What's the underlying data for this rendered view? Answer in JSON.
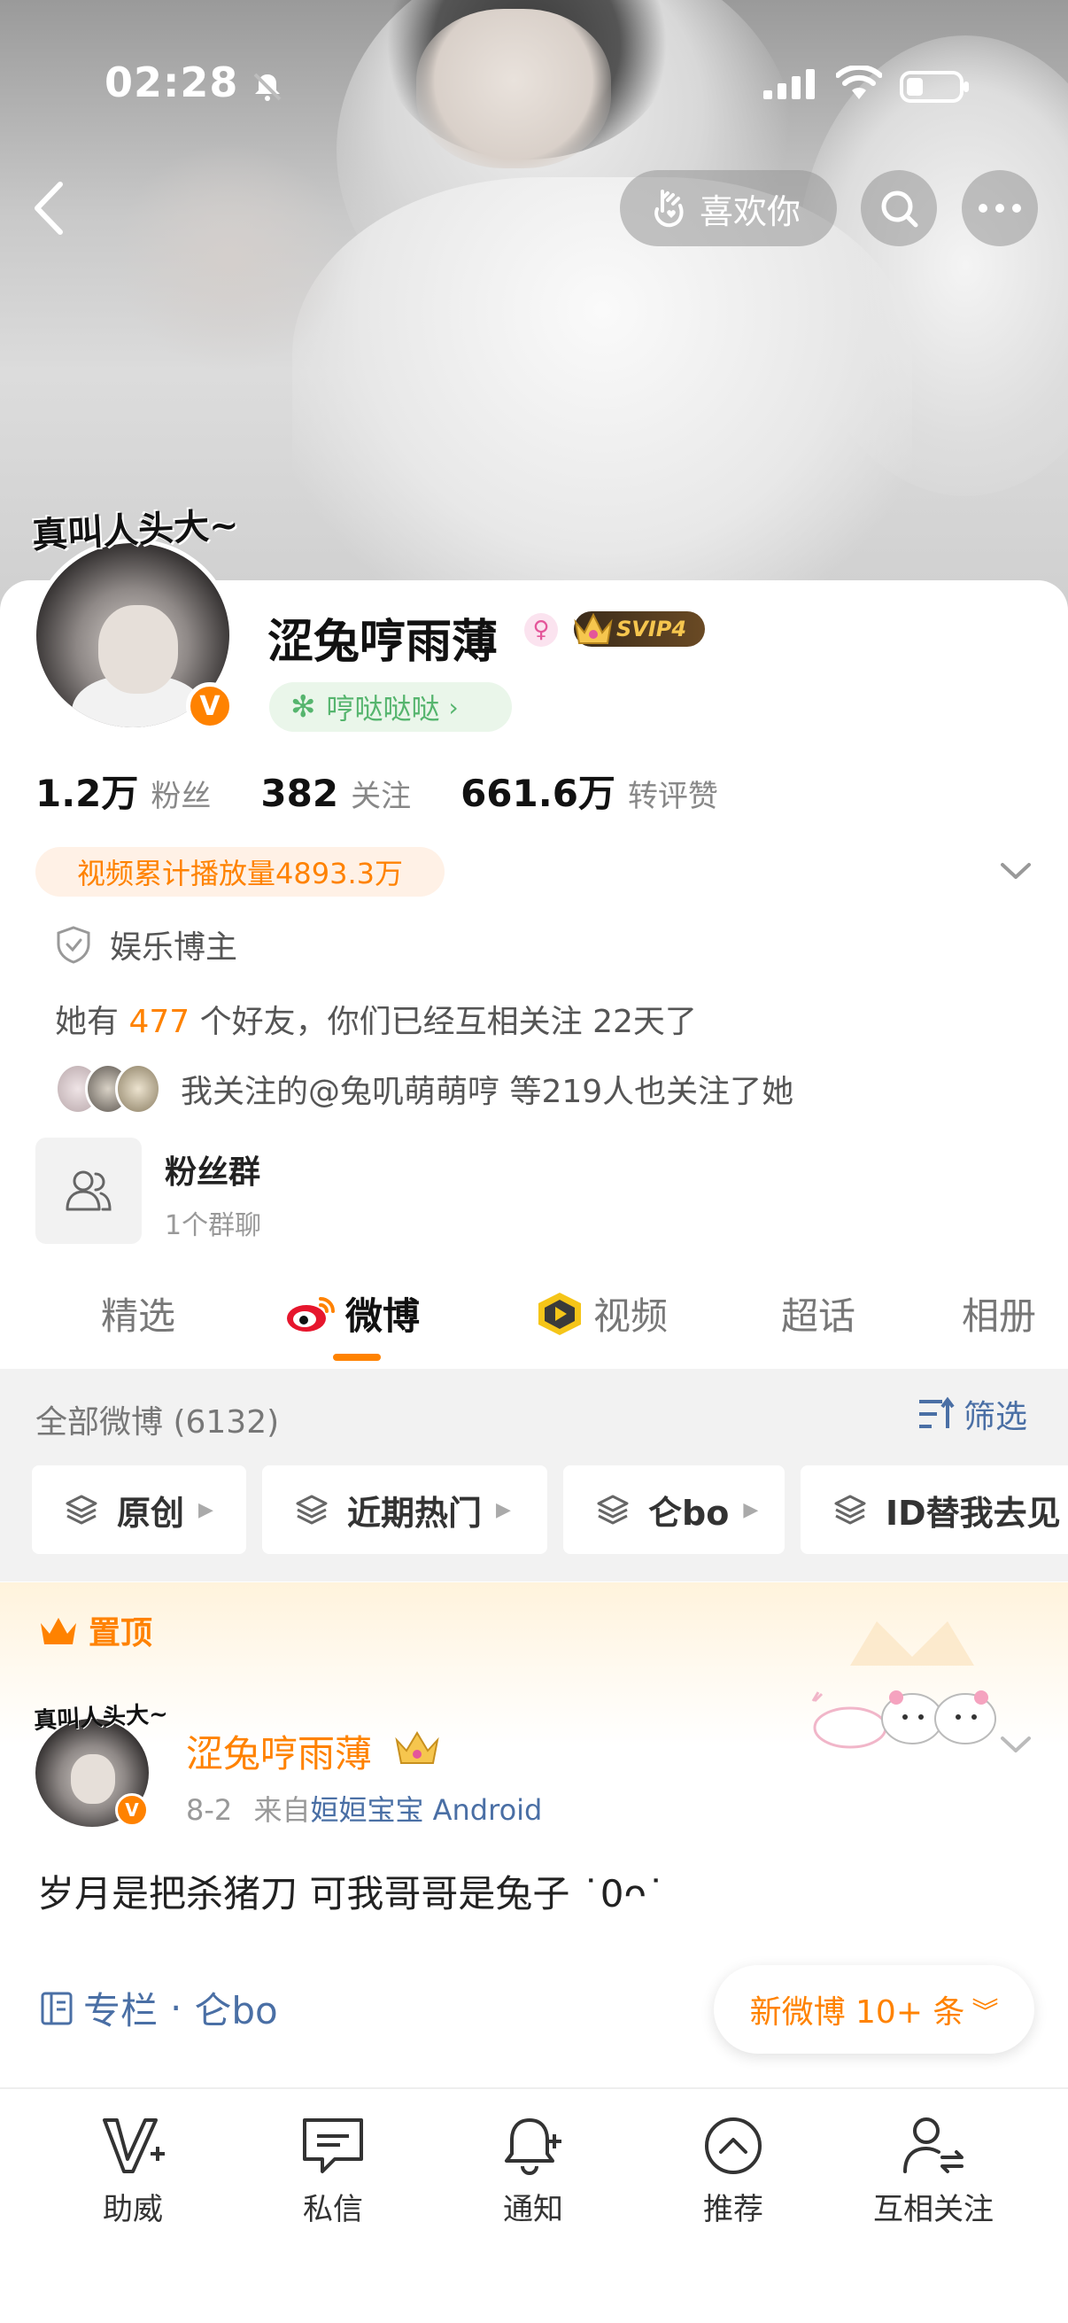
{
  "status_bar": {
    "time": "02:28"
  },
  "top_nav": {
    "like_label": "喜欢你"
  },
  "profile": {
    "avatar_tag": "真叫人头大~",
    "name": "涩兔哼雨薄",
    "gender_symbol": "♀",
    "vip_label": "SVIP4",
    "tag_label": "哼哒哒哒",
    "stats": [
      {
        "num": "1.2万",
        "label": "粉丝"
      },
      {
        "num": "382",
        "label": "关注"
      },
      {
        "num": "661.6万",
        "label": "转评赞"
      }
    ],
    "play_count": "视频累计播放量4893.3万",
    "blogger_type": "娱乐博主",
    "friends_pre": "她有",
    "friends_count": "477",
    "friends_post": "个好友，你们已经互相关注 22天了",
    "mutual_text": "我关注的@兔叽萌萌哼 等219人也关注了她",
    "fans_group_title": "粉丝群",
    "fans_group_sub": "1个群聊"
  },
  "tabs": [
    "精选",
    "微博",
    "视频",
    "超话",
    "相册"
  ],
  "active_tab": "微博",
  "feed": {
    "all_label": "全部微博 (6132)",
    "filter_label": "筛选",
    "chips": [
      "原创",
      "近期热门",
      "仑bo",
      "ID替我去见"
    ]
  },
  "pinned": {
    "label": "置顶",
    "avatar_tag": "真叫人头大~",
    "author": "涩兔哼雨薄",
    "date": "8-2",
    "from": "来自",
    "source": "姮姮宝宝 Android",
    "text": "岁月是把杀猪刀 可我哥哥是兔子 ˙0ᴖ˙",
    "column_label": "专栏",
    "column_name": "仑bo",
    "new_weibo": "新微博 10+ 条"
  },
  "bottom_bar": [
    "助威",
    "私信",
    "通知",
    "推荐",
    "互相关注"
  ],
  "colors": {
    "accent": "#ff8200",
    "link": "#4a6fa5",
    "tag_green": "#56b56e"
  }
}
